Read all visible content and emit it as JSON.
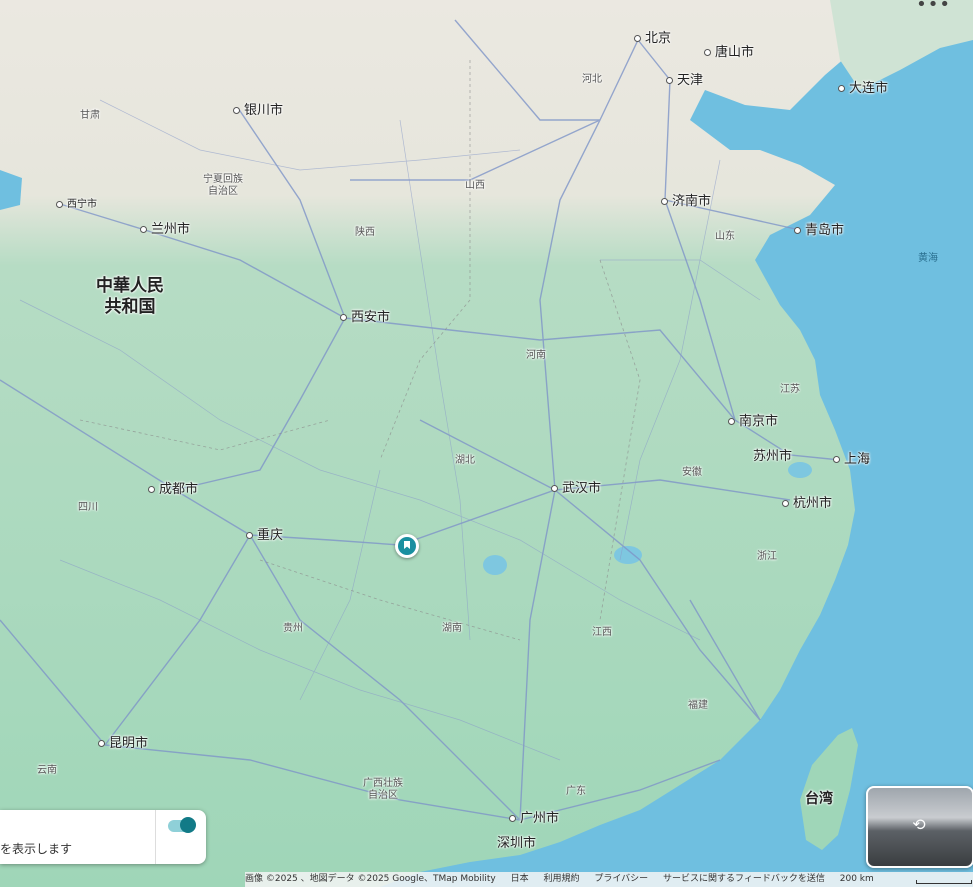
{
  "cities": [
    {
      "id": "beijing",
      "label": "北京"
    },
    {
      "id": "tangshan",
      "label": "唐山市"
    },
    {
      "id": "tianjin",
      "label": "天津"
    },
    {
      "id": "dalian",
      "label": "大连市"
    },
    {
      "id": "yinchuan",
      "label": "银川市"
    },
    {
      "id": "jinan",
      "label": "济南市"
    },
    {
      "id": "qingdao",
      "label": "青岛市"
    },
    {
      "id": "xining",
      "label": "西宁市"
    },
    {
      "id": "lanzhou",
      "label": "兰州市"
    },
    {
      "id": "xian",
      "label": "西安市"
    },
    {
      "id": "nanjing",
      "label": "南京市"
    },
    {
      "id": "suzhou",
      "label": "苏州市"
    },
    {
      "id": "shanghai",
      "label": "上海"
    },
    {
      "id": "wuhan",
      "label": "武汉市"
    },
    {
      "id": "hangzhou",
      "label": "杭州市"
    },
    {
      "id": "chengdu",
      "label": "成都市"
    },
    {
      "id": "chongqing",
      "label": "重庆"
    },
    {
      "id": "kunming",
      "label": "昆明市"
    },
    {
      "id": "guangzhou",
      "label": "广州市"
    },
    {
      "id": "shenzhen",
      "label": "深圳市"
    }
  ],
  "regions": {
    "gansu": "甘肃",
    "hebei": "河北",
    "ningxia": "宁夏回族\n自治区",
    "shanxi": "山西",
    "shaanxi": "陕西",
    "shandong": "山东",
    "henan": "河南",
    "jiangsu": "江苏",
    "hubei": "湖北",
    "anhui": "安徽",
    "sichuan": "四川",
    "zhejiang": "浙江",
    "guizhou": "贵州",
    "hunan": "湖南",
    "jiangxi": "江西",
    "fujian": "福建",
    "yunnan": "云南",
    "guangxi": "广西壮族\n自治区",
    "guangdong": "广东"
  },
  "seas": {
    "yellow_sea": "黄海"
  },
  "country_label": "中華人民\n共和国",
  "island_label": "台湾",
  "toggle_card": {
    "text": "を表示します",
    "enabled": true
  },
  "more_menu": "•••",
  "footer": {
    "attribution": "画像 ©2025 、地図データ ©2025 Google、TMap Mobility",
    "region": "日本",
    "terms": "利用規約",
    "privacy": "プライバシー",
    "feedback": "サービスに関するフィードバックを送信",
    "scale": "200 km"
  },
  "colors": {
    "land": "#a9d9bf",
    "north_land": "#e9e7e1",
    "sea": "#6fbfe0",
    "roads": "#7f95c8",
    "accent": "#127a87"
  }
}
